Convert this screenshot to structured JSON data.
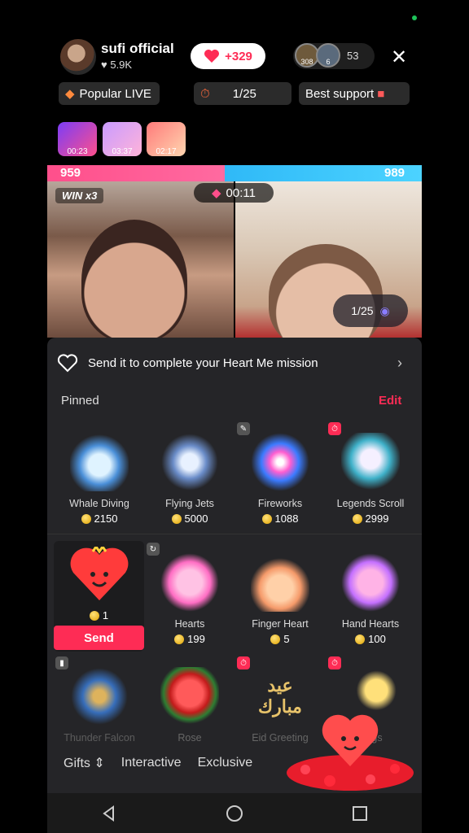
{
  "host": {
    "name": "sufi official",
    "likes": "5.9K"
  },
  "like_counter": "+329",
  "viewers": {
    "avatars": [
      "308",
      "6"
    ],
    "count": "53"
  },
  "chips": {
    "popular": "Popular LIVE",
    "rank": "1/25",
    "best_supporter": "Best support"
  },
  "gift_timers": [
    "00:23",
    "03:37",
    "02:17"
  ],
  "battle": {
    "left_score": "959",
    "right_score": "989",
    "timer": "00:11",
    "win_streak": "WIN x3",
    "page": "1/25"
  },
  "mission": {
    "text": "Send it to complete your Heart Me mission"
  },
  "pinned": {
    "label": "Pinned",
    "edit": "Edit"
  },
  "pinned_gifts": [
    {
      "name": "Whale Diving",
      "price": "2150"
    },
    {
      "name": "Flying Jets",
      "price": "5000"
    },
    {
      "name": "Fireworks",
      "price": "1088"
    },
    {
      "name": "Legends Scroll",
      "price": "2999"
    }
  ],
  "row2_gifts": [
    {
      "name": "",
      "price": "1"
    },
    {
      "name": "Hearts",
      "price": "199"
    },
    {
      "name": "Finger Heart",
      "price": "5"
    },
    {
      "name": "Hand Hearts",
      "price": "100"
    }
  ],
  "row3_gifts": [
    {
      "name": "Thunder Falcon",
      "price": ""
    },
    {
      "name": "Rose",
      "price": ""
    },
    {
      "name": "Eid Greeting",
      "price": ""
    },
    {
      "name": "Hugs",
      "price": ""
    }
  ],
  "row3_overlay_text": "عيد مبارك",
  "send_label": "Send",
  "tabs": {
    "gifts": "Gifts",
    "interactive": "Interactive",
    "exclusive": "Exclusive"
  },
  "colors": {
    "accent": "#fe2c55",
    "blue": "#2fb9f7",
    "panel": "#252528",
    "coin": "#e0a200"
  },
  "icons": [
    "heart-icon",
    "close-icon",
    "fire-icon",
    "stopwatch-icon",
    "coin-icon",
    "chevron-right-icon",
    "back-icon",
    "home-icon",
    "recents-icon"
  ]
}
